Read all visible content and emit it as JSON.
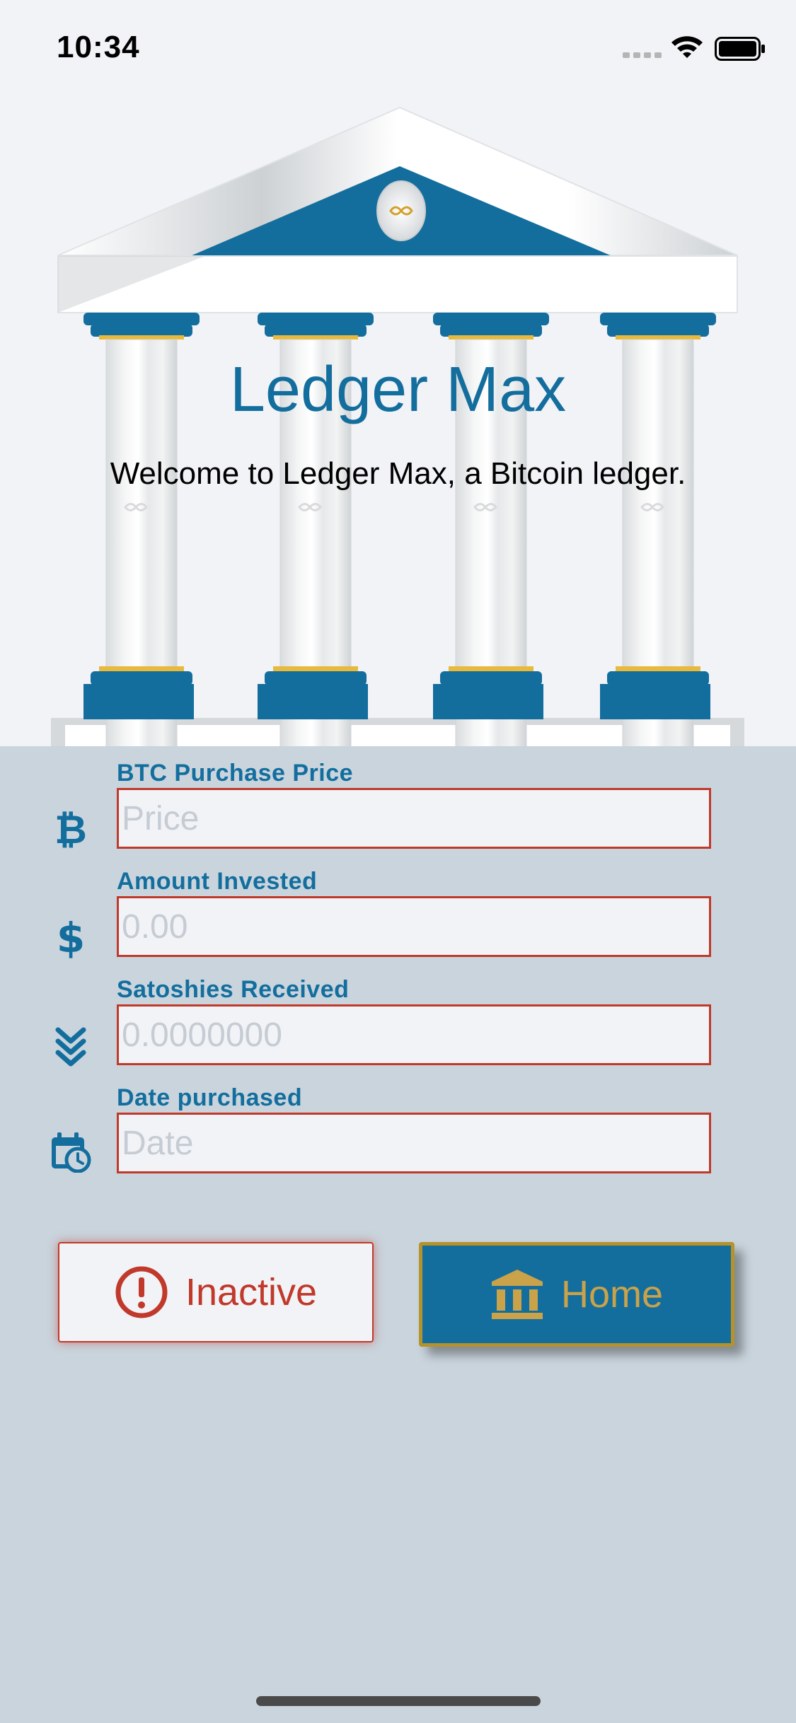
{
  "status_bar": {
    "time": "10:34"
  },
  "hero": {
    "title": "Ledger Max",
    "welcome": "Welcome to Ledger Max, a Bitcoin ledger."
  },
  "fields": [
    {
      "label": "BTC Purchase Price",
      "placeholder": "Price",
      "icon": "bitcoin-icon"
    },
    {
      "label": "Amount Invested",
      "placeholder": "0.00",
      "icon": "dollar-icon"
    },
    {
      "label": "Satoshies Received",
      "placeholder": "0.0000000",
      "icon": "double-chevron-down-icon"
    },
    {
      "label": "Date purchased",
      "placeholder": "Date",
      "icon": "calendar-clock-icon"
    }
  ],
  "buttons": {
    "inactive_label": "Inactive",
    "home_label": "Home"
  },
  "colors": {
    "accent_blue": "#136e9e",
    "error_red": "#c0392b",
    "gold": "#b5922a",
    "form_background": "#c9d4dd"
  }
}
